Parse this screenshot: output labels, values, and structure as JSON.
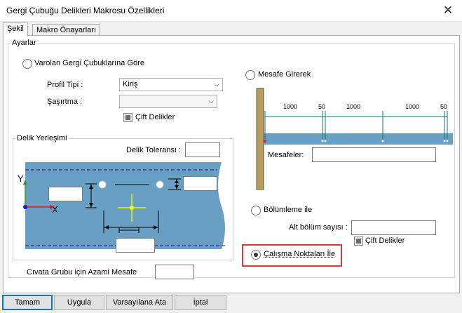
{
  "window": {
    "title": "Gergi Çubuğu Delikleri Makrosu Özellikleri"
  },
  "tabs": [
    {
      "label": "Şekil"
    },
    {
      "label": "Makro Önayarları"
    }
  ],
  "settings": {
    "group_title": "Ayarlar",
    "radio_existing": "Varolan Gergi Çubuklarına Göre",
    "profile_type_label": "Profil Tipi :",
    "profile_type_value": "Kiriş",
    "stagger_label": "Şaşırtma :",
    "stagger_value": "",
    "double_holes_label": "Çift Delikler",
    "hole_placement": {
      "group_title": "Delik Yerleşimi",
      "tolerance_label": "Delik Toleransı :",
      "axis_y": "Y",
      "axis_x": "X"
    },
    "max_distance_label": "Cıvata Grubu için Azami Mesafe",
    "radio_distance": "Mesafe Girerek",
    "dim_labels": [
      "1000",
      "50",
      "1000",
      "1000",
      "50"
    ],
    "distances_label": "Mesafeler:",
    "radio_division": "Bölümleme ile",
    "sub_division_label": "Alt bölüm sayısı :",
    "double_holes_label_2": "Çift Delikler",
    "radio_workpoints": "Çalışma Noktaları İle"
  },
  "buttons": {
    "ok": "Tamam",
    "apply": "Uygula",
    "default": "Varsayılana Ata",
    "cancel": "İptal"
  },
  "colors": {
    "beam": "#6a9fc4",
    "dim_teal": "#0f7a6a",
    "highlight": "#d93a3a",
    "column": "#b89b58"
  }
}
